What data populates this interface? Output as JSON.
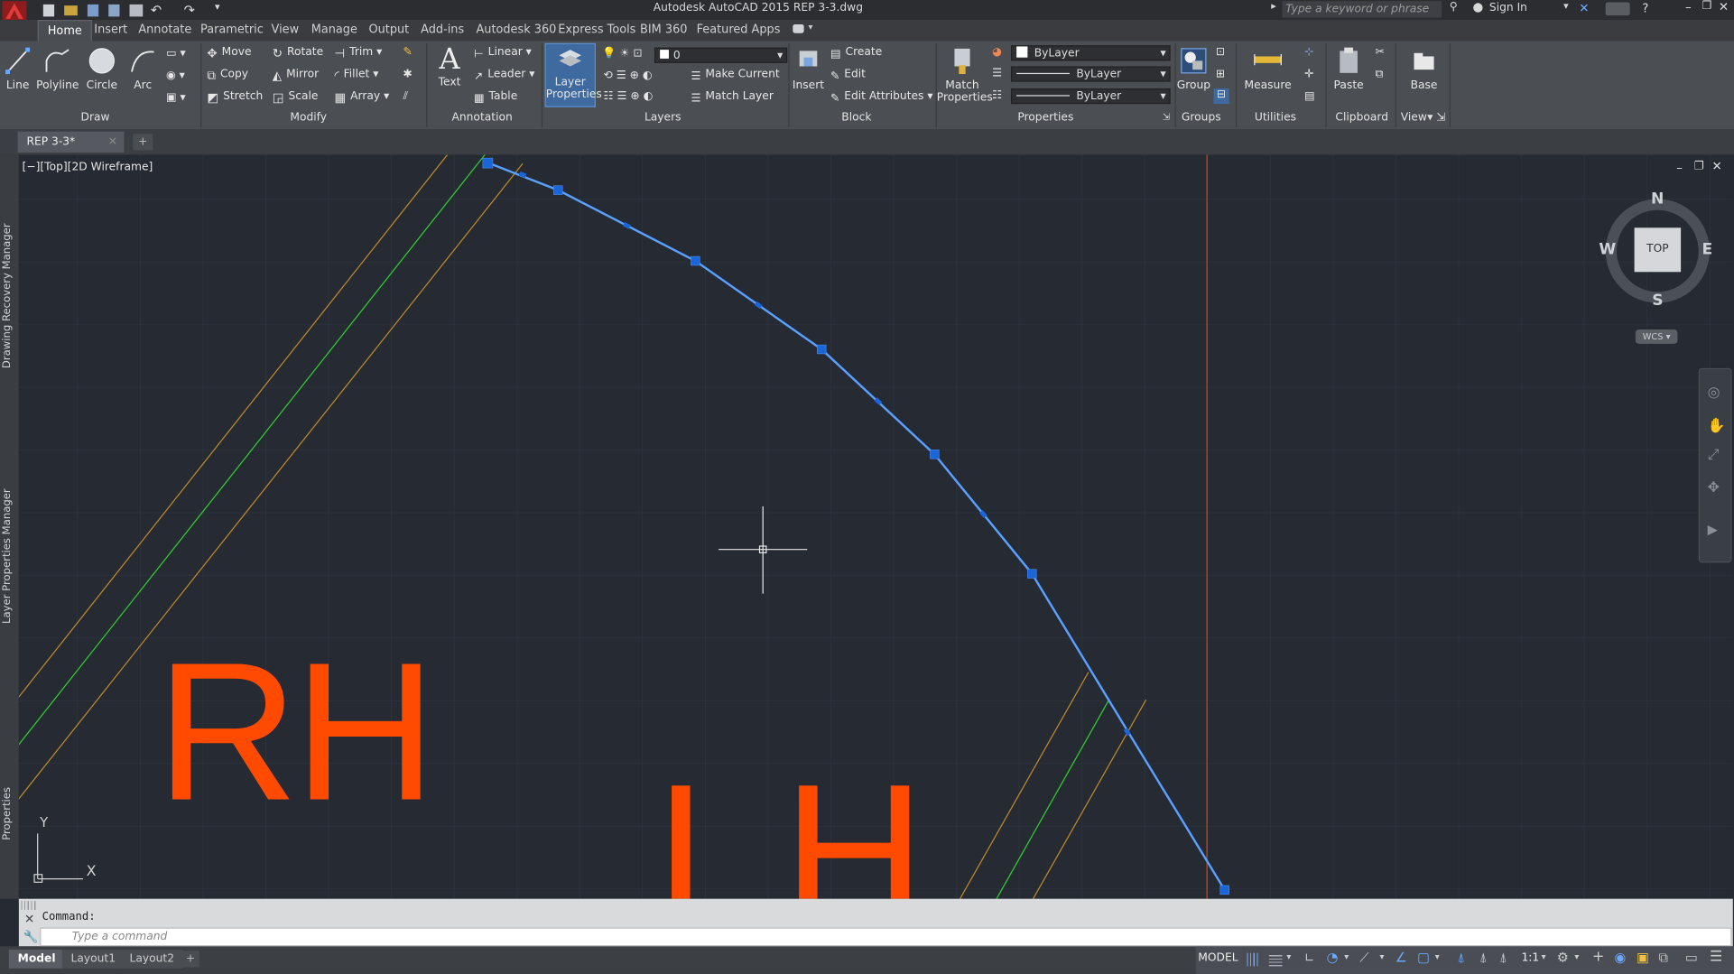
{
  "window": {
    "title": "Autodesk AutoCAD 2015    REP 3-3.dwg",
    "search_placeholder": "Type a keyword or phrase",
    "sign_in": "Sign In"
  },
  "ribbon_tabs": [
    "Home",
    "Insert",
    "Annotate",
    "Parametric",
    "View",
    "Manage",
    "Output",
    "Add-ins",
    "Autodesk 360",
    "Express Tools",
    "BIM 360",
    "Featured Apps"
  ],
  "draw": {
    "title": "Draw",
    "line": "Line",
    "polyline": "Polyline",
    "circle": "Circle",
    "arc": "Arc"
  },
  "modify": {
    "title": "Modify",
    "move": "Move",
    "rotate": "Rotate",
    "trim": "Trim",
    "copy": "Copy",
    "mirror": "Mirror",
    "fillet": "Fillet",
    "stretch": "Stretch",
    "scale": "Scale",
    "array": "Array"
  },
  "annotation": {
    "title": "Annotation",
    "text": "Text",
    "linear": "Linear",
    "leader": "Leader",
    "table": "Table"
  },
  "layers": {
    "title": "Layers",
    "layer_properties": "Layer Properties",
    "current_layer": "0",
    "make_current": "Make Current",
    "match_layer": "Match Layer"
  },
  "block": {
    "title": "Block",
    "insert": "Insert",
    "create": "Create",
    "edit": "Edit",
    "edit_attributes": "Edit Attributes"
  },
  "properties": {
    "title": "Properties",
    "match_properties": "Match Properties",
    "color": "ByLayer",
    "linetype": "ByLayer",
    "lineweight": "ByLayer"
  },
  "groups": {
    "title": "Groups",
    "group": "Group"
  },
  "utilities": {
    "title": "Utilities",
    "measure": "Measure"
  },
  "clipboard": {
    "title": "Clipboard",
    "paste": "Paste"
  },
  "view_panel": {
    "title": "View",
    "base": "Base"
  },
  "doc_tab": "REP 3-3*",
  "palettes": {
    "drawing_recovery": "Drawing Recovery Manager",
    "layer_properties_manager": "Layer Properties Manager",
    "properties": "Properties"
  },
  "viewport": {
    "label": "[−][Top][2D Wireframe]",
    "text_rh": "RH",
    "text_lh": "LH",
    "ucs_x": "X",
    "ucs_y": "Y",
    "colors": {
      "orange_text": "#ff4a00",
      "green_line": "#2fd12f",
      "tan_line": "#c08a2a",
      "blue_poly": "#5aa0ff",
      "grip": "#1a66d9",
      "red_line": "#c5471c"
    }
  },
  "viewcube": {
    "n": "N",
    "s": "S",
    "e": "E",
    "w": "W",
    "face": "TOP",
    "wcs": "WCS"
  },
  "command": {
    "history": "Command:",
    "placeholder": "Type a command"
  },
  "layout_tabs": [
    "Model",
    "Layout1",
    "Layout2"
  ],
  "status": {
    "model": "MODEL",
    "scale": "1:1"
  }
}
